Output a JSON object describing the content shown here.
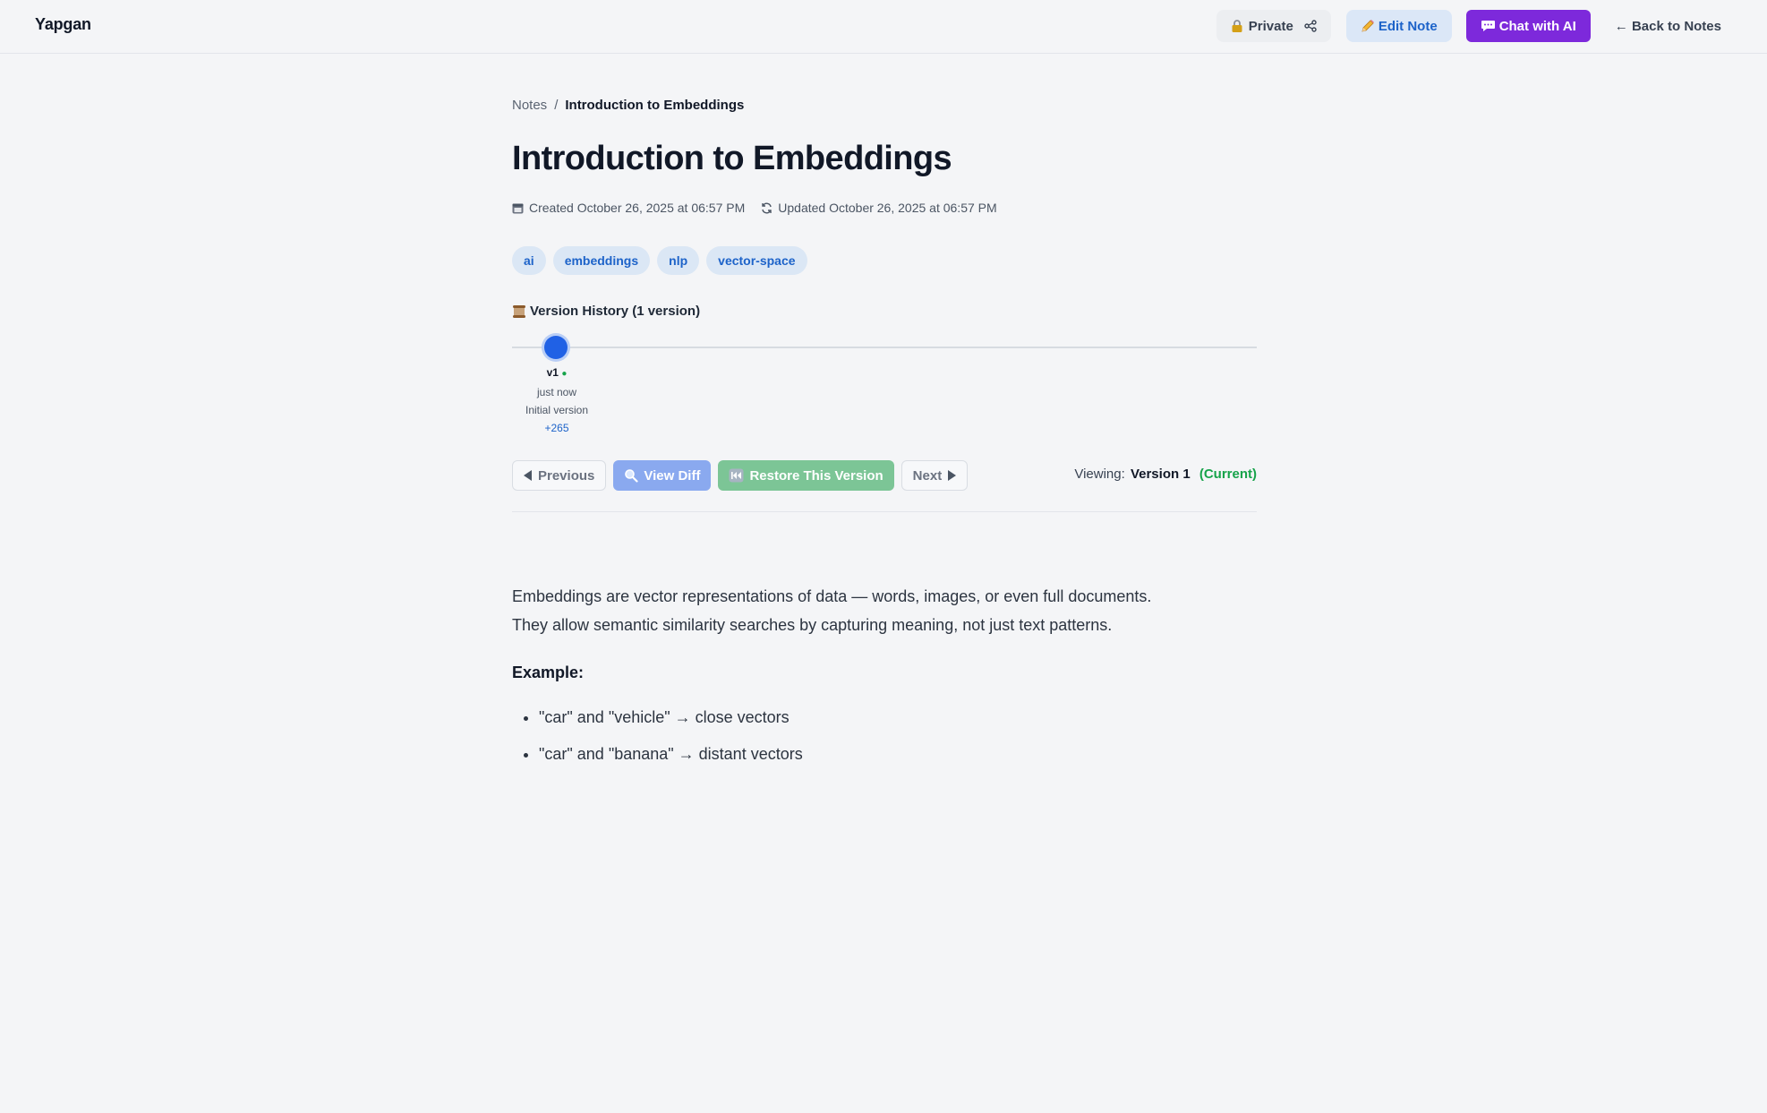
{
  "app": {
    "name": "Yapgan"
  },
  "header": {
    "private_label": "Private",
    "private_icon": "lock-icon",
    "share_icon": "share-icon",
    "edit_label": "Edit Note",
    "edit_icon": "pencil-icon",
    "chat_label": "Chat with AI",
    "chat_icon": "speech-bubble-icon",
    "back_label": "← Back to Notes",
    "colors": {
      "chat_bg": "#7d29db",
      "edit_bg": "#dbe7f7",
      "edit_text": "#1d63c9"
    }
  },
  "breadcrumb": {
    "root": "Notes",
    "separator": "/",
    "current": "Introduction to Embeddings"
  },
  "note": {
    "title": "Introduction to Embeddings",
    "created": "Created October 26, 2025 at 06:57 PM",
    "updated": "Updated October 26, 2025 at 06:57 PM",
    "tags": [
      "ai",
      "embeddings",
      "nlp",
      "vector-space"
    ]
  },
  "version_history": {
    "title": "Version History (1 version)",
    "icon": "scroll-icon",
    "versions": [
      {
        "label": "v1",
        "time": "just now",
        "message": "Initial version",
        "change": "+265",
        "is_current": true
      }
    ],
    "controls": {
      "previous": "Previous",
      "view_diff": "View Diff",
      "restore": "Restore This Version",
      "next": "Next"
    },
    "viewing_prefix": "Viewing:",
    "viewing_version": "Version 1",
    "viewing_status": "(Current)"
  },
  "content": {
    "para1": "Embeddings are vector representations of data — words, images, or even full documents.",
    "para2": "They allow semantic similarity searches by capturing meaning, not just text patterns.",
    "example_heading": "Example:",
    "examples": [
      "\"car\" and \"vehicle\" → close vectors",
      "\"car\" and \"banana\" → distant vectors"
    ]
  }
}
